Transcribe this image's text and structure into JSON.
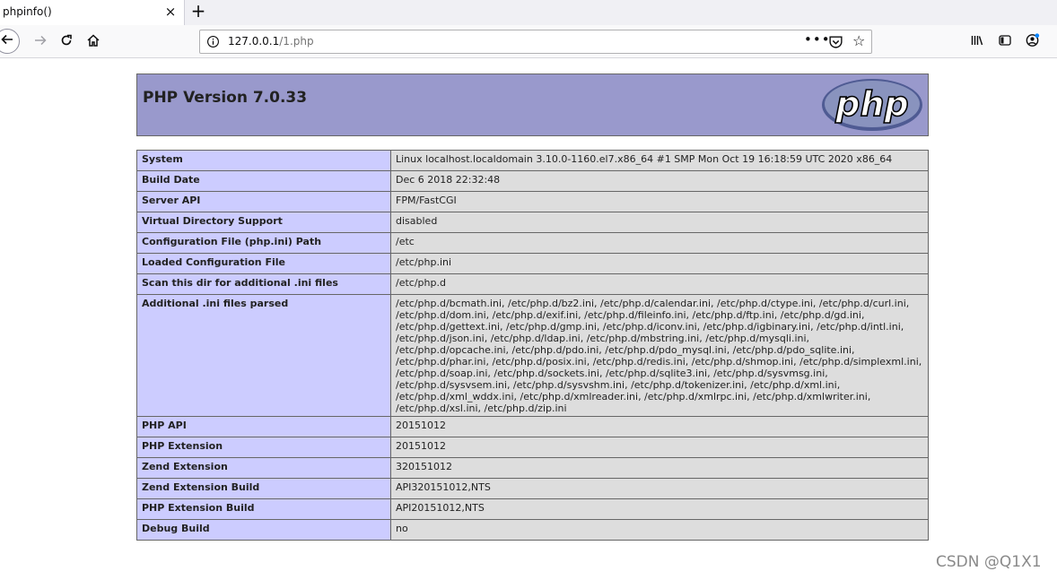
{
  "browser": {
    "tab_title": "phpinfo()",
    "tab_close": "×",
    "new_tab": "+",
    "url_host": "127.0.0.1",
    "url_path": "/1.php",
    "page_actions": "•••"
  },
  "page": {
    "version_title": "PHP Version 7.0.33",
    "logo_text": "php",
    "rows": [
      {
        "label": "System",
        "value": "Linux localhost.localdomain 3.10.0-1160.el7.x86_64 #1 SMP Mon Oct 19 16:18:59 UTC 2020 x86_64"
      },
      {
        "label": "Build Date",
        "value": "Dec 6 2018 22:32:48"
      },
      {
        "label": "Server API",
        "value": "FPM/FastCGI"
      },
      {
        "label": "Virtual Directory Support",
        "value": "disabled"
      },
      {
        "label": "Configuration File (php.ini) Path",
        "value": "/etc"
      },
      {
        "label": "Loaded Configuration File",
        "value": "/etc/php.ini"
      },
      {
        "label": "Scan this dir for additional .ini files",
        "value": "/etc/php.d"
      },
      {
        "label": "Additional .ini files parsed",
        "value": "/etc/php.d/bcmath.ini, /etc/php.d/bz2.ini, /etc/php.d/calendar.ini, /etc/php.d/ctype.ini, /etc/php.d/curl.ini, /etc/php.d/dom.ini, /etc/php.d/exif.ini, /etc/php.d/fileinfo.ini, /etc/php.d/ftp.ini, /etc/php.d/gd.ini, /etc/php.d/gettext.ini, /etc/php.d/gmp.ini, /etc/php.d/iconv.ini, /etc/php.d/igbinary.ini, /etc/php.d/intl.ini, /etc/php.d/json.ini, /etc/php.d/ldap.ini, /etc/php.d/mbstring.ini, /etc/php.d/mysqli.ini, /etc/php.d/opcache.ini, /etc/php.d/pdo.ini, /etc/php.d/pdo_mysql.ini, /etc/php.d/pdo_sqlite.ini, /etc/php.d/phar.ini, /etc/php.d/posix.ini, /etc/php.d/redis.ini, /etc/php.d/shmop.ini, /etc/php.d/simplexml.ini, /etc/php.d/soap.ini, /etc/php.d/sockets.ini, /etc/php.d/sqlite3.ini, /etc/php.d/sysvmsg.ini, /etc/php.d/sysvsem.ini, /etc/php.d/sysvshm.ini, /etc/php.d/tokenizer.ini, /etc/php.d/xml.ini, /etc/php.d/xml_wddx.ini, /etc/php.d/xmlreader.ini, /etc/php.d/xmlrpc.ini, /etc/php.d/xmlwriter.ini, /etc/php.d/xsl.ini, /etc/php.d/zip.ini"
      },
      {
        "label": "PHP API",
        "value": "20151012"
      },
      {
        "label": "PHP Extension",
        "value": "20151012"
      },
      {
        "label": "Zend Extension",
        "value": "320151012"
      },
      {
        "label": "Zend Extension Build",
        "value": "API320151012,NTS"
      },
      {
        "label": "PHP Extension Build",
        "value": "API20151012,NTS"
      },
      {
        "label": "Debug Build",
        "value": "no"
      }
    ]
  },
  "watermark": "CSDN @Q1X1",
  "colors": {
    "header_bg": "#9999cc",
    "label_bg": "#ccccff",
    "value_bg": "#dddddd",
    "logo_oval": "#6c7eb7"
  },
  "icons": {
    "back": "back-arrow-icon",
    "forward": "forward-arrow-icon",
    "reload": "reload-icon",
    "home": "home-icon",
    "info": "info-icon",
    "pocket": "pocket-icon",
    "bookmark": "star-icon",
    "library": "library-icon",
    "sidebar": "sidebar-icon",
    "account": "account-icon"
  }
}
